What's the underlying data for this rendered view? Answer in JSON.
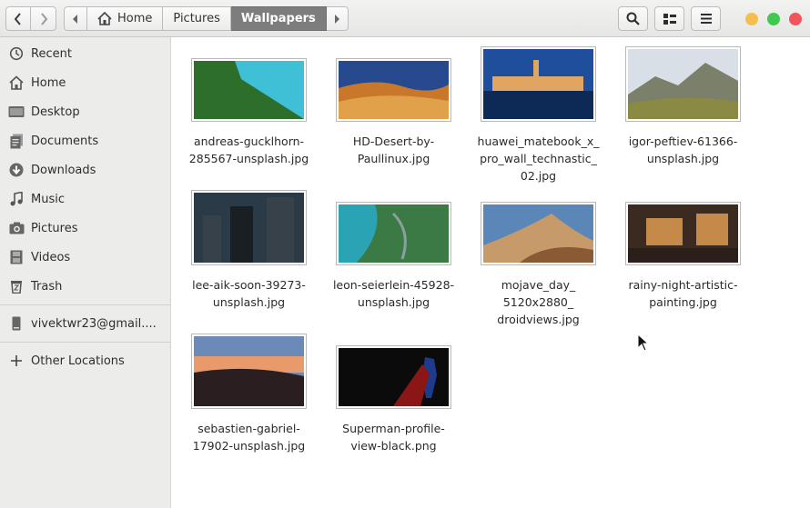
{
  "headerbar": {
    "path": [
      "Home",
      "Pictures",
      "Wallpapers"
    ],
    "nav_icons": [
      "back-icon",
      "forward-icon"
    ],
    "tools": [
      "search-icon",
      "view-icon",
      "menu-icon"
    ],
    "window_colors": {
      "minimize": "#f4bf4f",
      "maximize": "#3fc950",
      "close": "#f2545b"
    }
  },
  "sidebar": {
    "items": [
      {
        "label": "Recent",
        "icon": "clock-icon"
      },
      {
        "label": "Home",
        "icon": "home-icon"
      },
      {
        "label": "Desktop",
        "icon": "desktop-icon"
      },
      {
        "label": "Documents",
        "icon": "documents-icon"
      },
      {
        "label": "Downloads",
        "icon": "download-icon"
      },
      {
        "label": "Music",
        "icon": "music-icon"
      },
      {
        "label": "Pictures",
        "icon": "camera-icon"
      },
      {
        "label": "Videos",
        "icon": "film-icon"
      },
      {
        "label": "Trash",
        "icon": "trash-icon"
      }
    ],
    "account": {
      "label": "vivektwr23@gmail....",
      "icon": "drive-icon"
    },
    "other": {
      "label": "Other Locations",
      "icon": "plus-icon"
    }
  },
  "files": [
    {
      "name1": "andreas-gucklhorn-",
      "name2": "285567-unsplash.jpg",
      "name3": "",
      "colors": [
        "#1c4a1c",
        "#2c6e2a",
        "#3fc0d6"
      ]
    },
    {
      "name1": "HD-Desert-by-",
      "name2": "Paullinux.jpg",
      "name3": "",
      "colors": [
        "#274a8f",
        "#c9772a",
        "#e1a04a"
      ]
    },
    {
      "name1": "huawei_matebook_x_",
      "name2": "pro_wall_technastic_",
      "name3": "02.jpg",
      "colors": [
        "#1f4f9c",
        "#e0a560",
        "#0c2a55"
      ]
    },
    {
      "name1": "igor-peftiev-61366-",
      "name2": "unsplash.jpg",
      "name3": "",
      "colors": [
        "#d8dfe6",
        "#7a8069",
        "#8b8a45"
      ]
    },
    {
      "name1": "lee-aik-soon-39273-",
      "name2": "unsplash.jpg",
      "name3": "",
      "colors": [
        "#2b3a47",
        "#36414a",
        "#1a1f24"
      ]
    },
    {
      "name1": "leon-seierlein-45928-",
      "name2": "unsplash.jpg",
      "name3": "",
      "colors": [
        "#2aa3b5",
        "#3b7a45",
        "#8aa0a0"
      ]
    },
    {
      "name1": "mojave_day_",
      "name2": "5120x2880_",
      "name3": "droidviews.jpg",
      "colors": [
        "#5a86b8",
        "#c79a6a",
        "#8a5a35"
      ]
    },
    {
      "name1": "rainy-night-artistic-",
      "name2": "painting.jpg",
      "name3": "",
      "colors": [
        "#3a2a20",
        "#c58a4a",
        "#2a1f1a"
      ]
    },
    {
      "name1": "sebastien-gabriel-",
      "name2": "17902-unsplash.jpg",
      "name3": "",
      "colors": [
        "#6b8ab8",
        "#e89a6a",
        "#2a1e20"
      ]
    },
    {
      "name1": "Superman-profile-",
      "name2": "view-black.png",
      "name3": "",
      "colors": [
        "#0b0b0b",
        "#1e3a8a",
        "#8a1616"
      ]
    }
  ]
}
